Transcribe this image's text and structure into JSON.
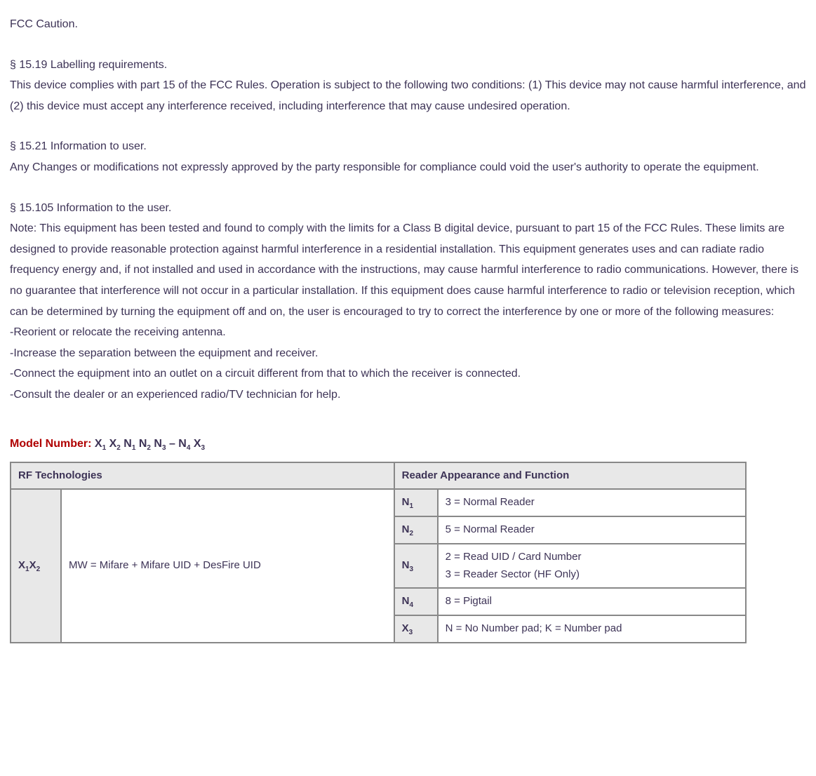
{
  "fcc_caution": "FCC Caution.",
  "s1519": {
    "heading": "§ 15.19 Labelling requirements.",
    "body": "This device complies with part 15 of the FCC Rules. Operation is subject to the following two conditions: (1) This device may not cause harmful interference, and (2) this device must accept any interference received, including interference that may cause undesired operation."
  },
  "s1521": {
    "heading": "§ 15.21 Information to user.",
    "body": "Any Changes or modifications not expressly approved by the party responsible for compliance could void the user's authority to operate the equipment."
  },
  "s15105": {
    "heading": "§ 15.105 Information to the user.",
    "body": "Note: This equipment has been tested and found to comply with the limits for a Class B digital device, pursuant to part 15 of the FCC Rules. These limits are designed to provide reasonable protection against harmful interference in a residential installation. This equipment generates uses and can radiate radio frequency energy and, if not installed and used in accordance with the instructions, may cause harmful interference to radio communications. However, there is no guarantee that interference will not occur in a particular installation. If this equipment does cause harmful interference to radio or television reception, which can be determined by turning the equipment off and on, the user is encouraged to try to correct the interference by one or more of the following measures:",
    "bullets": [
      "-Reorient or relocate the receiving antenna.",
      "-Increase the separation between the equipment and receiver.",
      "-Connect the equipment into an outlet on a circuit different from that to which the receiver is connected.",
      "-Consult the dealer or an experienced radio/TV technician for help."
    ]
  },
  "model": {
    "label": "Model Number: ",
    "pattern_parts": [
      "X",
      "1",
      " X",
      "2",
      " N",
      "1",
      " N",
      "2",
      " N",
      "3",
      " – N",
      "4",
      " X",
      "3"
    ]
  },
  "table": {
    "header_left": "RF Technologies",
    "header_right": "Reader Appearance and Function",
    "left_key": "X₁X₂",
    "left_key_parts": [
      "X",
      "1",
      "X",
      "2"
    ],
    "left_val": "MW = Mifare + Mifare UID + DesFire UID",
    "rows": [
      {
        "key_parts": [
          "N",
          "1"
        ],
        "val": "3 = Normal Reader"
      },
      {
        "key_parts": [
          "N",
          "2"
        ],
        "val": "5 = Normal Reader"
      },
      {
        "key_parts": [
          "N",
          "3"
        ],
        "val": "2 = Read UID / Card Number\n3 = Reader Sector (HF Only)"
      },
      {
        "key_parts": [
          "N",
          "4"
        ],
        "val": "8 = Pigtail"
      },
      {
        "key_parts": [
          "X",
          "3"
        ],
        "val": "N = No Number pad; K = Number pad"
      }
    ]
  }
}
